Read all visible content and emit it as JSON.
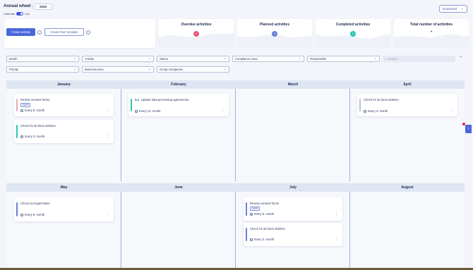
{
  "header": {
    "title": "Annual wheel",
    "year": "2025",
    "prev": "‹",
    "next": "›",
    "view_calendar": "Calendar",
    "view_list": "List",
    "download": "Download"
  },
  "actions": {
    "create_activity": "Create activity",
    "create_from_template": "Create from template",
    "info": "i"
  },
  "stats": [
    {
      "label": "Overdue activities",
      "value": "1",
      "color": "#e8577a"
    },
    {
      "label": "Planned activities",
      "value": "4",
      "color": "#6a7fd6"
    },
    {
      "label": "Completed activities",
      "value": "2",
      "color": "#2ec4b2"
    },
    {
      "label": "Total number of activities",
      "value": "•",
      "color": ""
    }
  ],
  "filters": {
    "month": "Month",
    "activity": "Activity",
    "status": "Status",
    "compliance_area": "Compliance area",
    "responsible": "Responsible",
    "search_placeholder": "Search",
    "priority": "Priority",
    "business_area": "Business area",
    "group_companies": "Group companies"
  },
  "months_row1": [
    "January",
    "February",
    "March",
    "April"
  ],
  "months_row2": [
    "May",
    "June",
    "July",
    "August"
  ],
  "cards": {
    "jan1": {
      "title": "Review consent forms",
      "tag": "GDPR",
      "repeat": "Every 6. month",
      "color": "#f2a7b5"
    },
    "jan2": {
      "title": "Check for de facto deletion",
      "repeat": "Every 3. month",
      "color": "#2ec4b2"
    },
    "feb1": {
      "num": "1.1",
      "title": "Update data processing agreements",
      "repeat": "Every 12. month",
      "color": "#2ec4b2"
    },
    "apr1": {
      "title": "Check for de facto deletion",
      "repeat": "Every 3. month",
      "color": "#b9c1d6"
    },
    "may1": {
      "title": "Check our legal bases",
      "repeat": "Every 6. month",
      "color": "#6a7fd6"
    },
    "jul1": {
      "title": "Review consent forms",
      "tag": "GDPR",
      "repeat": "Every 6. month",
      "color": "#6a7fd6"
    },
    "jul2": {
      "title": "Check for de facto deletion",
      "repeat": "Every 3. month",
      "color": "#6a7fd6"
    }
  },
  "more": "⋮",
  "side_tab": "i"
}
